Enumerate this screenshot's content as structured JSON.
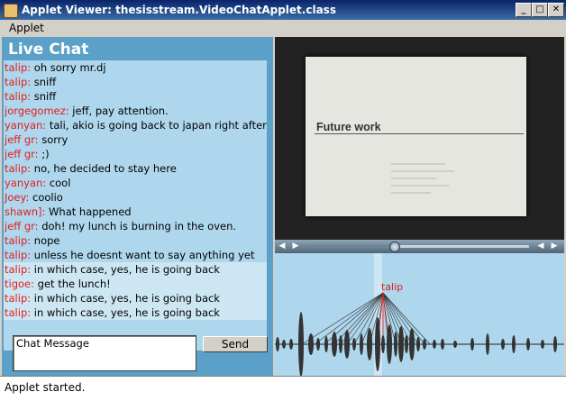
{
  "window": {
    "title": "Applet Viewer: thesisstream.VideoChatApplet.class",
    "minimize_glyph": "_",
    "maximize_glyph": "□",
    "close_glyph": "✕"
  },
  "menu": {
    "applet": "Applet"
  },
  "chat": {
    "title": "Live Chat",
    "messages": [
      {
        "user": "talip:",
        "text": " oh sorry mr.dj",
        "highlight": false
      },
      {
        "user": "talip:",
        "text": " sniff",
        "highlight": false
      },
      {
        "user": "talip:",
        "text": " sniff",
        "highlight": false
      },
      {
        "user": "jorgegomez:",
        "text": " jeff, pay attention.",
        "highlight": false
      },
      {
        "user": "yanyan:",
        "text": " tali, akio is going back to japan right after grad,",
        "highlight": false
      },
      {
        "user": "jeff gr:",
        "text": " sorry",
        "highlight": false
      },
      {
        "user": "jeff gr:",
        "text": " ;)",
        "highlight": false
      },
      {
        "user": "talip:",
        "text": " no, he decided to stay here",
        "highlight": false
      },
      {
        "user": "yanyan:",
        "text": " cool",
        "highlight": false
      },
      {
        "user": "Joey:",
        "text": " coolio",
        "highlight": false
      },
      {
        "user": "shawn]:",
        "text": " What happened",
        "highlight": false
      },
      {
        "user": "jeff gr:",
        "text": " doh! my lunch is burning in the oven.",
        "highlight": false
      },
      {
        "user": "talip:",
        "text": " nope",
        "highlight": false
      },
      {
        "user": "talip:",
        "text": " unless he doesnt want to say anything yet",
        "highlight": false
      },
      {
        "user": "talip:",
        "text": " in which case, yes, he is going back",
        "highlight": true
      },
      {
        "user": "tigoe:",
        "text": " get the lunch!",
        "highlight": true
      },
      {
        "user": "talip:",
        "text": " in which case, yes, he is going back",
        "highlight": true
      },
      {
        "user": "talip:",
        "text": " in which case, yes, he is going back",
        "highlight": true
      }
    ],
    "input_value": "Chat Message",
    "send_label": "Send"
  },
  "video": {
    "slide_title": "Future work",
    "progress": 0.39
  },
  "timeline": {
    "user_label": "talip"
  },
  "status": {
    "text": "Applet started."
  },
  "colors": {
    "chat_bg": "#5aa0c8",
    "log_bg": "#aed6ec",
    "username": "#e02020",
    "timeline_bg": "#aed6ec"
  }
}
